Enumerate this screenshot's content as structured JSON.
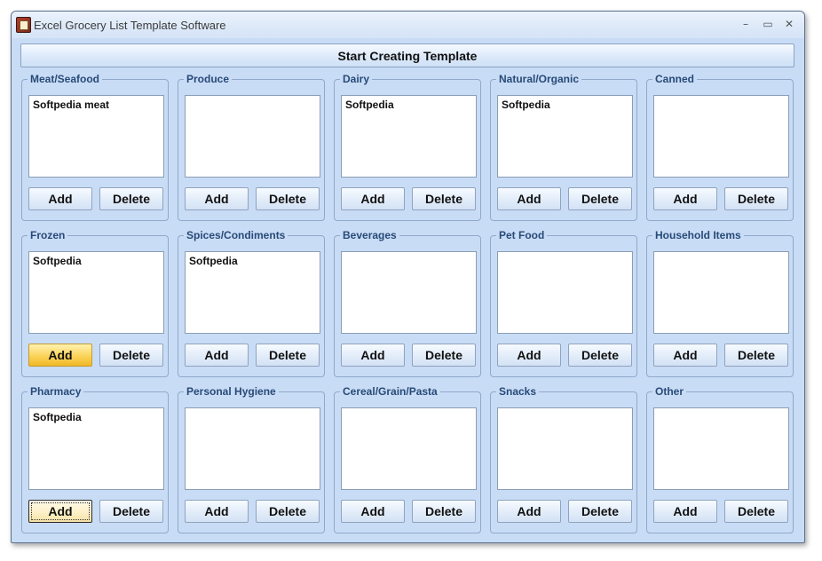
{
  "window": {
    "title": "Excel Grocery List Template Software",
    "controls": {
      "minimize": "–",
      "maximize": "▭",
      "close": "✕"
    }
  },
  "start_button": "Start Creating Template",
  "buttons": {
    "add": "Add",
    "delete": "Delete"
  },
  "groups": [
    {
      "label": "Meat/Seafood",
      "items": [
        "Softpedia meat"
      ]
    },
    {
      "label": "Produce",
      "items": []
    },
    {
      "label": "Dairy",
      "items": [
        "Softpedia"
      ]
    },
    {
      "label": "Natural/Organic",
      "items": [
        "Softpedia"
      ]
    },
    {
      "label": "Canned",
      "items": []
    },
    {
      "label": "Frozen",
      "items": [
        "Softpedia"
      ]
    },
    {
      "label": "Spices/Condiments",
      "items": [
        "Softpedia"
      ]
    },
    {
      "label": "Beverages",
      "items": []
    },
    {
      "label": "Pet Food",
      "items": []
    },
    {
      "label": "Household Items",
      "items": []
    },
    {
      "label": "Pharmacy",
      "items": [
        "Softpedia"
      ]
    },
    {
      "label": "Personal Hygiene",
      "items": []
    },
    {
      "label": "Cereal/Grain/Pasta",
      "items": []
    },
    {
      "label": "Snacks",
      "items": []
    },
    {
      "label": "Other",
      "items": []
    }
  ],
  "colors": {
    "window_bg": "#c9dcf5",
    "label_text": "#274a78",
    "hover_add": "#fbd35a"
  }
}
